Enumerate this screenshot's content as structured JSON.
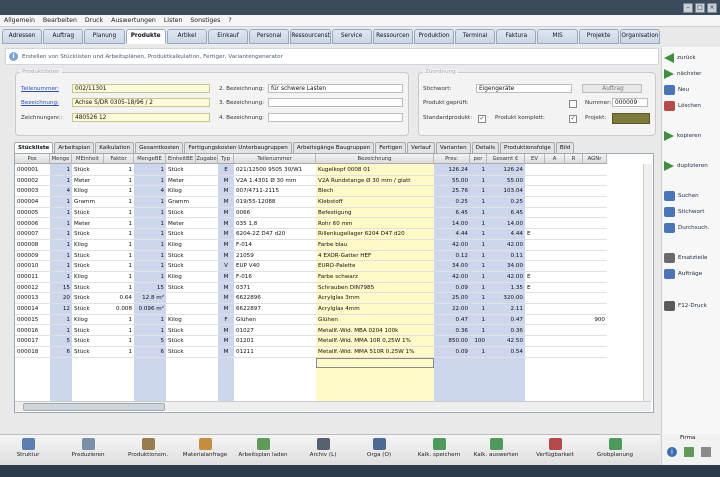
{
  "menu": [
    "Allgemein",
    "Bearbeiten",
    "Druck",
    "Auswertungen",
    "Listen",
    "Sonstiges",
    "?"
  ],
  "module_tabs": [
    {
      "label": "Adressen",
      "active": false
    },
    {
      "label": "Auftrag",
      "active": false
    },
    {
      "label": "Planung",
      "active": false
    },
    {
      "label": "Produkte",
      "active": true
    },
    {
      "label": "Artikel",
      "active": false
    },
    {
      "label": "Einkauf",
      "active": false
    },
    {
      "label": "Personal",
      "active": false
    },
    {
      "label": "Ressourcenste",
      "active": false
    },
    {
      "label": "Service",
      "active": false
    },
    {
      "label": "Ressourcen",
      "active": false
    },
    {
      "label": "Produktion",
      "active": false
    },
    {
      "label": "Terminal",
      "active": false
    },
    {
      "label": "Faktura",
      "active": false
    },
    {
      "label": "MIS",
      "active": false
    },
    {
      "label": "Projekte",
      "active": false
    },
    {
      "label": "Organisation",
      "active": false
    }
  ],
  "info_text": "Erstellen von Stücklisten und Arbeitsplänen, Produktkalkulation, Fertiger, Variantengenerator",
  "header": {
    "group_left_title": "Produktdaten",
    "teilenummer_label": "Teilenummer:",
    "teilenummer_value": "002/11301",
    "bezeichnung_label": "Bezeichnung:",
    "bezeichnung_value": "Achse S/DR 0305-18/96 / 2",
    "zeichnungsnr_label": "Zeichnungsnr.:",
    "zeichnungsnr_value": "480526 12",
    "bez2_label": "2. Bezeichnung:",
    "bez2_value": "für schwere Lasten",
    "bez3_label": "3. Bezeichnung:",
    "bez3_value": "",
    "bez4_label": "4. Bezeichnung:",
    "bez4_value": "",
    "group_right_title": "Zuordnung",
    "stichwort_label": "Stichwort:",
    "stichwort_value": "Eigengeräte",
    "auftrag_button": "Auftrag",
    "geprueft_label": "Produkt geprüft:",
    "nummer_label": "Nummer:",
    "nummer_value": "000009",
    "standard_label": "Standardprodukt:",
    "komplett_label": "Produkt komplett:",
    "projekt_label": "Projekt:"
  },
  "sub_tabs": [
    {
      "label": "Stückliste",
      "active": true
    },
    {
      "label": "Arbeitsplan",
      "active": false
    },
    {
      "label": "Kalkulation",
      "active": false
    },
    {
      "label": "Gesamtkosten",
      "active": false
    },
    {
      "label": "Fertigungskosten Unterbaugruppen",
      "active": false
    },
    {
      "label": "Arbeitsgänge Baugruppen",
      "active": false
    },
    {
      "label": "Fertigen",
      "active": false
    },
    {
      "label": "Verlauf",
      "active": false
    },
    {
      "label": "Varianten",
      "active": false
    },
    {
      "label": "Details",
      "active": false
    },
    {
      "label": "Produktionsfolge",
      "active": false
    },
    {
      "label": "Bild",
      "active": false
    }
  ],
  "grid": {
    "columns": [
      "Pos",
      "Menge",
      "MEinheit",
      "Faktor",
      "MengeBE",
      "EinheitBE",
      "Zugabe",
      "Typ",
      "Teilenummer",
      "Bezeichnung",
      "Prev.",
      "per",
      "Gesamt €",
      "EV",
      "A",
      "R",
      "AGNr"
    ],
    "rows": [
      [
        "000001",
        "1",
        "Stück",
        "1",
        "1",
        "Stück",
        "",
        "E",
        "021/12500 9505 30/W1",
        "Kugelkopf 0008 01",
        "126.24",
        "1",
        "126.24",
        "",
        "",
        "",
        ""
      ],
      [
        "000002",
        "1",
        "Meter",
        "1",
        "1",
        "Meter",
        "",
        "M",
        "V2A 1.4301 Ø 30 mm",
        "V2A Rundstange Ø 30 mm / glatt",
        "55.00",
        "1",
        "55.00",
        "",
        "",
        "",
        ""
      ],
      [
        "000003",
        "4",
        "Kilog",
        "1",
        "4",
        "Kilog",
        "",
        "M",
        "007/4711-2115",
        "Blech",
        "25.76",
        "1",
        "103.04",
        "",
        "",
        "",
        ""
      ],
      [
        "000004",
        "1",
        "Gramm",
        "1",
        "1",
        "Gramm",
        "",
        "M",
        "019/55-12088",
        "Klebstoff",
        "0.25",
        "1",
        "0.25",
        "",
        "",
        "",
        ""
      ],
      [
        "000005",
        "1",
        "Stück",
        "1",
        "1",
        "Stück",
        "",
        "M",
        "0066",
        "Befestigung",
        "6.45",
        "1",
        "6.45",
        "",
        "",
        "",
        ""
      ],
      [
        "000006",
        "1",
        "Meter",
        "1",
        "1",
        "Meter",
        "",
        "M",
        "035 1,8",
        "Rohr 60 mm",
        "14.00",
        "1",
        "14.00",
        "",
        "",
        "",
        ""
      ],
      [
        "000007",
        "1",
        "Stück",
        "1",
        "1",
        "Stück",
        "",
        "M",
        "6204-2Z D47 d20",
        "Rillenkugellager 6204 D47 d20",
        "4.44",
        "1",
        "4.44",
        "E",
        "",
        "",
        ""
      ],
      [
        "000008",
        "1",
        "Kilog",
        "1",
        "1",
        "Kilog",
        "",
        "M",
        "F-014",
        "Farbe blau",
        "42.00",
        "1",
        "42.00",
        "",
        "",
        "",
        ""
      ],
      [
        "000009",
        "1",
        "Stück",
        "1",
        "1",
        "Stück",
        "",
        "M",
        "21059",
        "4 EXOR-Gatter HEF",
        "0.12",
        "1",
        "0.11",
        "",
        "",
        "",
        ""
      ],
      [
        "000010",
        "1",
        "Stück",
        "1",
        "1",
        "Stück",
        "",
        "V",
        "EUP V40",
        "EURO-Palette",
        "34.00",
        "1",
        "34.00",
        "",
        "",
        "",
        ""
      ],
      [
        "000011",
        "1",
        "Kilog",
        "1",
        "1",
        "Kilog",
        "",
        "M",
        "F-016",
        "Farbe schwarz",
        "42.00",
        "1",
        "42.00",
        "E",
        "",
        "",
        ""
      ],
      [
        "000012",
        "15",
        "Stück",
        "1",
        "15",
        "Stück",
        "",
        "M",
        "0371",
        "Schrauben DIN7985",
        "0.09",
        "1",
        "1.35",
        "E",
        "",
        "",
        ""
      ],
      [
        "000013",
        "20",
        "Stück",
        "0.64",
        "12.8 m²",
        "",
        "",
        "M",
        "6622896",
        "Acrylglas 3mm",
        "25.00",
        "1",
        "320.00",
        "",
        "",
        "",
        ""
      ],
      [
        "000014",
        "12",
        "Stück",
        "0.008",
        "0.096 m²",
        "",
        "",
        "M",
        "6622897",
        "Acrylglas 4mm",
        "22.00",
        "1",
        "2.11",
        "",
        "",
        "",
        ""
      ],
      [
        "000015",
        "1",
        "Kilog",
        "1",
        "1",
        "Kilog",
        "",
        "F",
        "Glühen",
        "Glühen",
        "0.47",
        "1",
        "0.47",
        "",
        "",
        "",
        "900"
      ],
      [
        "000016",
        "1",
        "Stück",
        "1",
        "1",
        "Stück",
        "",
        "M",
        "01027",
        "Metallf.-Wid. MBA  0204 100k",
        "0.36",
        "1",
        "0.36",
        "",
        "",
        "",
        ""
      ],
      [
        "000017",
        "5",
        "Stück",
        "1",
        "5",
        "Stück",
        "",
        "M",
        "01201",
        "Metallf.-Wid. MMA 10R 0,25W 1%",
        "850.00",
        "100",
        "42.50",
        "",
        "",
        "",
        ""
      ],
      [
        "000018",
        "6",
        "Stück",
        "1",
        "6",
        "Stück",
        "",
        "M",
        "01211",
        "Metallf.-Wid. MMA 510R 0,25W 1%",
        "0.09",
        "1",
        "0.54",
        "",
        "",
        "",
        ""
      ]
    ]
  },
  "actions": [
    {
      "label": "zurück",
      "icon": "arrow-left-icon"
    },
    {
      "label": "nächster",
      "icon": "arrow-right-icon"
    },
    {
      "label": "Neu",
      "icon": "new-document-icon"
    },
    {
      "label": "Löschen",
      "icon": "delete-icon"
    },
    {
      "label": "kopieren",
      "icon": "copy-icon"
    },
    {
      "label": "duplizieren",
      "icon": "duplicate-icon"
    },
    {
      "label": "Suchen",
      "icon": "search-icon"
    },
    {
      "label": "Stichwort",
      "icon": "keyword-search-icon"
    },
    {
      "label": "Durchsuch.",
      "icon": "browse-icon"
    },
    {
      "label": "Ersatzteile",
      "icon": "spare-parts-icon"
    },
    {
      "label": "Aufträge",
      "icon": "orders-icon"
    },
    {
      "label": "F12-Druck",
      "icon": "print-icon"
    }
  ],
  "bottom_tools": [
    {
      "label": "Struktur",
      "color": "#5a7fb0"
    },
    {
      "label": "Produzieren",
      "color": "#7a8ea6"
    },
    {
      "label": "Produktionsm.",
      "color": "#9a7c4a"
    },
    {
      "label": "Materialanfrage",
      "color": "#c58d3e"
    },
    {
      "label": "Arbeitsplan laden",
      "color": "#5f9a5a"
    },
    {
      "label": "Archiv (L)",
      "color": "#556070"
    },
    {
      "label": "Orga (O)",
      "color": "#4d6a92"
    },
    {
      "label": "Kalk. speichern",
      "color": "#4e9a5a"
    },
    {
      "label": "Kalk. auswerten",
      "color": "#4e9a5a"
    },
    {
      "label": "Verfügbarkeit",
      "color": "#b54848"
    },
    {
      "label": "Grobplanung",
      "color": "#4e9a5a"
    }
  ],
  "firma_label": "Firma",
  "colors": {
    "accent": "#3a6fb5",
    "field_yellow": "#fffbd9",
    "highlight_blue": "#ccd7ee",
    "highlight_yellow": "#fff9c8",
    "title_bar": "#3b4b5c"
  }
}
